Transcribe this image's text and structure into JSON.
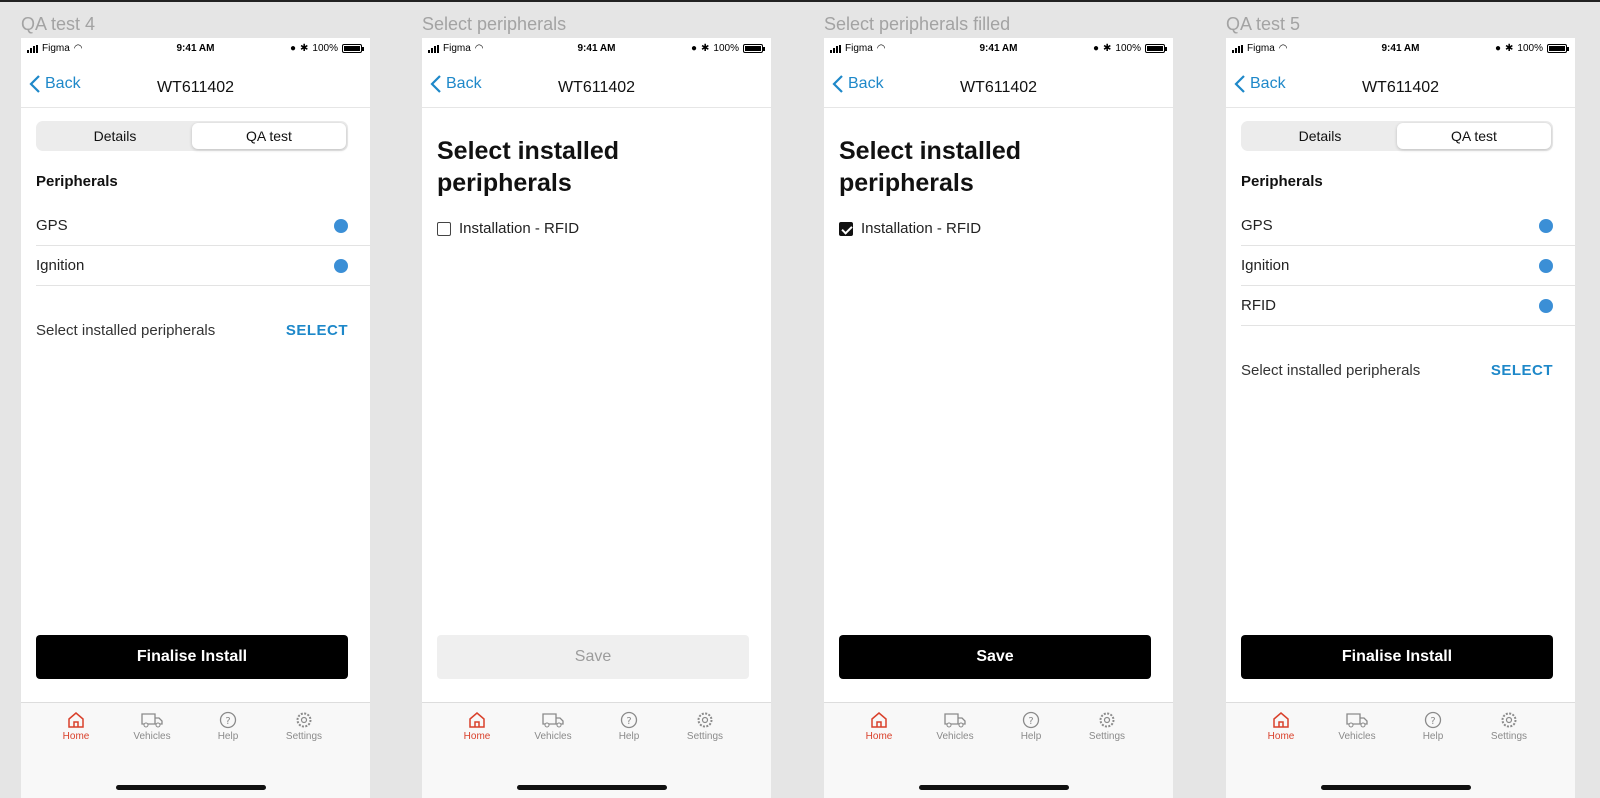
{
  "status_bar": {
    "carrier": "Figma",
    "time": "9:41 AM",
    "battery": "100%"
  },
  "navbar": {
    "back_label": "Back",
    "title": "WT611402"
  },
  "tabs": {
    "details": "Details",
    "qa_test": "QA test"
  },
  "tab_bar": {
    "home": "Home",
    "vehicles": "Vehicles",
    "help": "Help",
    "settings": "Settings"
  },
  "frames": {
    "qa4": {
      "label": "QA test 4",
      "section_title": "Peripherals",
      "peripherals": [
        "GPS",
        "Ignition"
      ],
      "select_text": "Select installed peripherals",
      "select_link": "SELECT",
      "button": "Finalise Install"
    },
    "select": {
      "label": "Select peripherals",
      "heading": "Select installed peripherals",
      "option": "Installation - RFID",
      "checked": false,
      "button": "Save"
    },
    "select_filled": {
      "label": "Select peripherals filled",
      "heading": "Select installed peripherals",
      "option": "Installation - RFID",
      "checked": true,
      "button": "Save"
    },
    "qa5": {
      "label": "QA test 5",
      "section_title": "Peripherals",
      "peripherals": [
        "GPS",
        "Ignition",
        "RFID"
      ],
      "select_text": "Select installed peripherals",
      "select_link": "SELECT",
      "button": "Finalise Install"
    }
  },
  "colors": {
    "accent": "#1e88c9",
    "dot": "#3b8fd6",
    "active_tab": "#d9402b"
  }
}
